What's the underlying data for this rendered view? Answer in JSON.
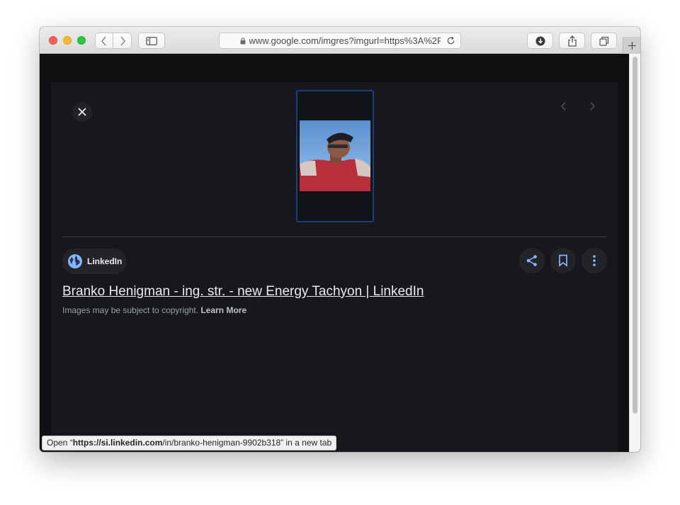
{
  "browser": {
    "url": "www.google.com/imgres?imgurl=https%3A%2F",
    "traffic_lights": [
      "close",
      "minimize",
      "zoom"
    ],
    "icons": {
      "back": "chevron-left-icon",
      "forward": "chevron-right-icon",
      "sidebar": "sidebar-icon",
      "lock": "lock-icon",
      "reload": "reload-icon",
      "downloads": "download-icon",
      "share": "share-icon",
      "tabs": "tabs-icon",
      "new_tab": "plus-icon"
    },
    "status_prefix": "Open “",
    "status_domain": "https://si.linkedin.com",
    "status_path": "/in/branko-henigman-9902b318",
    "status_suffix": "” in a new tab"
  },
  "viewer": {
    "source_name": "LinkedIn",
    "title": "Branko Henigman - ing. str. - new Energy Tachyon | LinkedIn",
    "copyright_text": "Images may be subject to copyright.",
    "learn_more": "Learn More",
    "icons": {
      "close": "close-icon",
      "prev": "chevron-left-icon",
      "next": "chevron-right-icon",
      "source": "globe-icon",
      "share": "share-icon",
      "save": "bookmark-icon",
      "more": "more-vertical-icon"
    },
    "colors": {
      "background": "#0f1012",
      "panel": "#17181b",
      "accent": "#8ab4f8",
      "selection_border": "#1a3f7a"
    }
  }
}
